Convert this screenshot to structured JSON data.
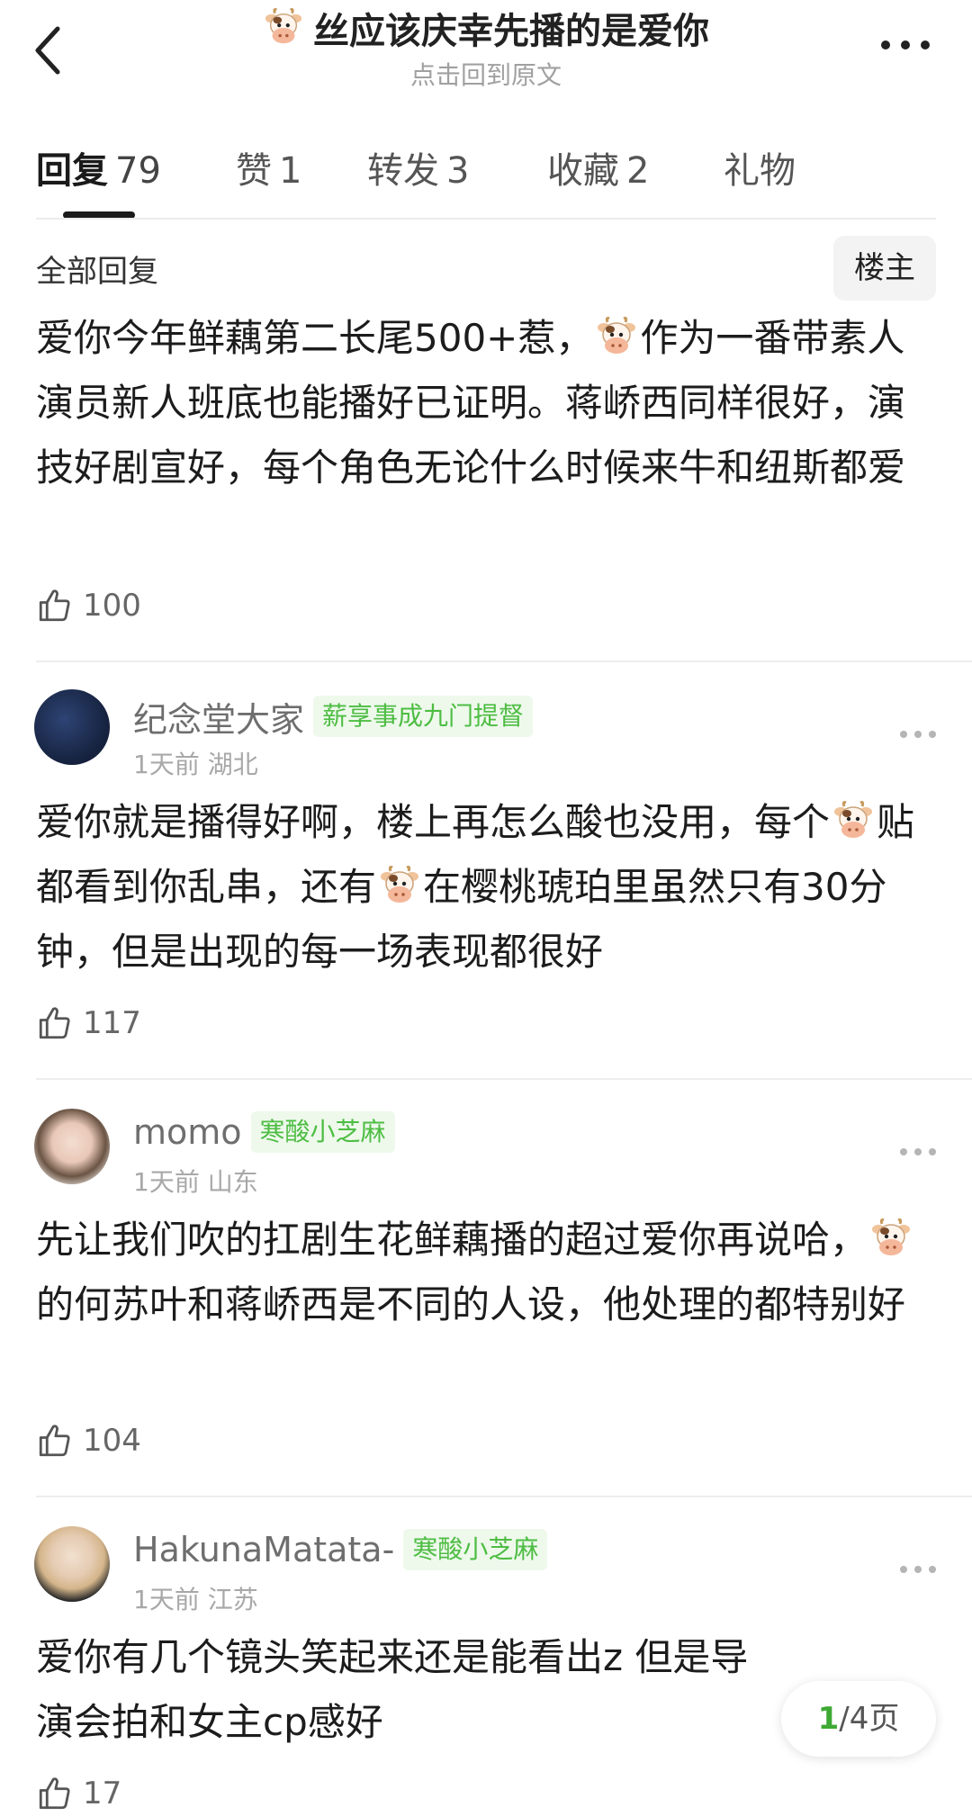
{
  "header": {
    "title": "丝应该庆幸先播的是爱你",
    "subtitle": "点击回到原文",
    "title_icon": "cow-emoji-icon"
  },
  "tabs": [
    {
      "label": "回复",
      "count": "79",
      "active": true
    },
    {
      "label": "赞",
      "count": "1",
      "active": false
    },
    {
      "label": "转发",
      "count": "3",
      "active": false
    },
    {
      "label": "收藏",
      "count": "2",
      "active": false
    },
    {
      "label": "礼物",
      "count": "",
      "active": false
    }
  ],
  "section": {
    "label": "全部回复",
    "owner_button": "楼主"
  },
  "posts": [
    {
      "author": "",
      "badge": "",
      "time": "",
      "location": "",
      "text": [
        "爱你今年鲜藕第二长尾500+惹，",
        "作为一番带素人演员新人班底也能播好已证明。蒋峤西同样很好，演技好剧宣好，每个角色无论什么时候来牛和纽斯都爱"
      ],
      "likes": "100"
    },
    {
      "author": "纪念堂大家",
      "badge": "薪享事成九门提督",
      "time": "1天前",
      "location": "湖北",
      "text": [
        "爱你就是播得好啊，楼上再怎么酸也没用，每个",
        "贴都看到你乱串，还有",
        "在樱桃琥珀里虽然只有30分钟，但是出现的每一场表现都很好"
      ],
      "likes": "117"
    },
    {
      "author": "momo",
      "badge": "寒酸小芝麻",
      "time": "1天前",
      "location": "山东",
      "text": [
        "先让我们吹的扛剧生花鲜藕播的超过爱你再说哈，",
        "的何苏叶和蒋峤西是不同的人设，他处理的都特别好"
      ],
      "likes": "104"
    },
    {
      "author": "HakunaMatata-",
      "badge": "寒酸小芝麻",
      "time": "1天前",
      "location": "江苏",
      "text": [
        "爱你有几个镜头笑起来还是能看出z 但是导演会拍和女主cp感好"
      ],
      "likes": "17"
    }
  ],
  "pager": {
    "current": "1",
    "total": "/4页"
  },
  "colors": {
    "badge_green": "#4ebd43",
    "pager_green": "#3ea933"
  }
}
